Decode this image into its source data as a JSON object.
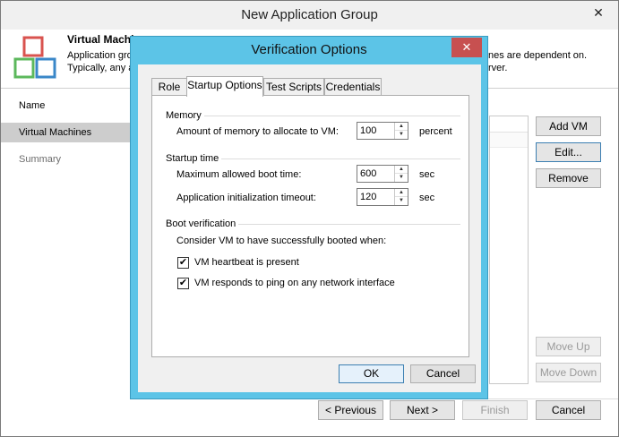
{
  "main": {
    "title": "New Application Group",
    "close_glyph": "✕",
    "header": {
      "title": "Virtual Machines",
      "desc_line1_left": "Application gro",
      "desc_line1_right": "nes are dependent on.",
      "desc_line2_left": "Typically, any a",
      "desc_line2_right": "rver."
    },
    "nav": [
      "Name",
      "Virtual Machines",
      "Summary"
    ],
    "buttons": {
      "add_vm": "Add VM",
      "edit": "Edit...",
      "remove": "Remove",
      "move_up": "Move Up",
      "move_down": "Move Down",
      "previous": "< Previous",
      "next": "Next >",
      "finish": "Finish",
      "cancel": "Cancel"
    }
  },
  "dialog": {
    "title": "Verification Options",
    "close_glyph": "✕",
    "tabs": [
      "Role",
      "Startup Options",
      "Test Scripts",
      "Credentials"
    ],
    "memory": {
      "group": "Memory",
      "label": "Amount of memory to allocate to VM:",
      "value": "100",
      "unit": "percent"
    },
    "startup_time": {
      "group": "Startup time",
      "boot_label": "Maximum allowed boot time:",
      "boot_value": "600",
      "boot_unit": "sec",
      "init_label": "Application initialization timeout:",
      "init_value": "120",
      "init_unit": "sec"
    },
    "boot_verification": {
      "group": "Boot verification",
      "intro": "Consider VM to have successfully booted when:",
      "heartbeat": "VM heartbeat is present",
      "ping": "VM responds to ping on any network interface",
      "check_glyph": "✔"
    },
    "ok": "OK",
    "cancel": "Cancel",
    "spin_up": "▲",
    "spin_down": "▼"
  },
  "colors": {
    "dialog_frame": "#5cc4e7",
    "close_button": "#c75050",
    "nav_active": "#cdcdcd"
  }
}
